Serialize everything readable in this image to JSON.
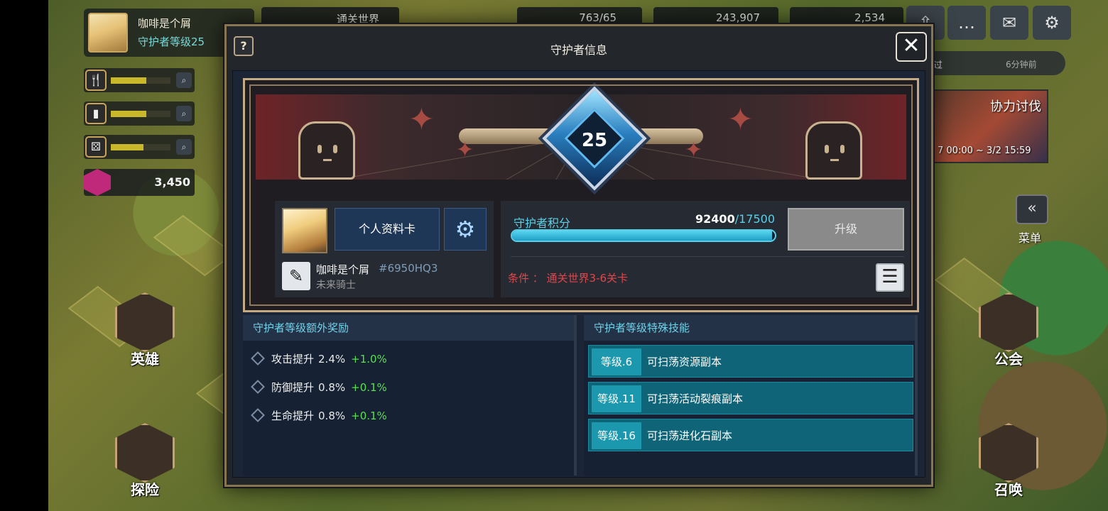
{
  "background": {
    "profile": {
      "name": "咖啡是个屑",
      "level": "守护者等级25"
    },
    "resources": [
      {
        "icon": "fork-knife-icon",
        "fill": 0.6
      },
      {
        "icon": "cup-icon",
        "fill": 0.6
      },
      {
        "icon": "dice-icon",
        "fill": 0.55
      }
    ],
    "gems": "3,450",
    "menus": {
      "hero": "英雄",
      "explore": "探险",
      "guild": "公会",
      "summon": "召唤"
    },
    "top_bar": {
      "res1": "763/65",
      "res2": "243,907",
      "res3": "2,534",
      "banner": "通关世界"
    },
    "news": {
      "label": "过",
      "time": "6分钟前"
    },
    "event": {
      "title": "协力讨伐",
      "time": "7 00:00 ~ 3/2 15:59"
    },
    "side_menu": "菜单"
  },
  "modal": {
    "title": "守护者信息",
    "help": "?",
    "close": "✕",
    "level": "25",
    "profile_card": "个人资料卡",
    "player_name": "咖啡是个屑",
    "player_id": "#6950HQ3",
    "player_title": "未来骑士",
    "points_label": "守护者积分",
    "points_current": "92400",
    "points_max": "/17500",
    "points_fill": 0.99,
    "levelup": "升级",
    "condition": "条件 ： 通关世界3-6关卡",
    "bonus_header": "守护者等级额外奖励",
    "bonuses": [
      {
        "label": "攻击提升",
        "value": "2.4%",
        "inc": "+1.0%"
      },
      {
        "label": "防御提升",
        "value": "0.8%",
        "inc": "+0.1%"
      },
      {
        "label": "生命提升",
        "value": "0.8%",
        "inc": "+0.1%"
      }
    ],
    "skills_header": "守护者等级特殊技能",
    "skills": [
      {
        "level": "等级.6",
        "text": "可扫荡资源副本"
      },
      {
        "level": "等级.11",
        "text": "可扫荡活动裂痕副本"
      },
      {
        "level": "等级.16",
        "text": "可扫荡进化石副本"
      }
    ]
  },
  "colors": {
    "accent": "#5ad0e8",
    "condition": "#e0474b",
    "increase": "#58e04d"
  }
}
